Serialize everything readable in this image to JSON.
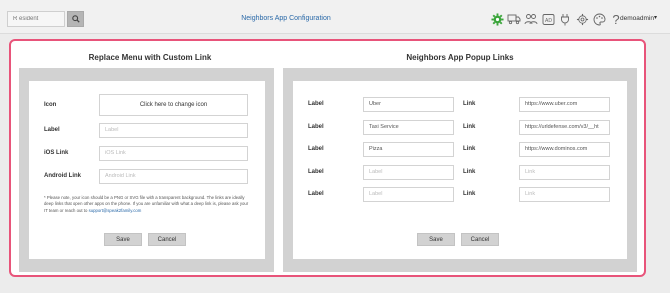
{
  "topbar": {
    "search_placeholder": "R esident",
    "title": "Neighbors App Configuration",
    "user": "demoadmin",
    "icons": [
      "settings-gear-icon",
      "truck-icon",
      "users-icon",
      "ad-icon",
      "plug-icon",
      "gear-icon",
      "palette-icon",
      "help-icon"
    ],
    "accent_color": "#3aa53a"
  },
  "left_panel": {
    "title": "Replace Menu with Custom Link",
    "icon_label": "Icon",
    "icon_button": "Click here to change icon",
    "label_label": "Label",
    "label_placeholder": "Label",
    "ios_label": "iOS Link",
    "ios_placeholder": "iOS Link",
    "android_label": "Android Link",
    "android_placeholder": "Android Link",
    "note_text": "* Please note, your icon should be a PNG or SVG file with a transparent background. The links are ideally deep links that open other apps on the phone. If you are unfamiliar with what a deep link is, please ask your IT team or reach out to",
    "note_link": "support@speak2family.com",
    "save": "Save",
    "cancel": "Cancel"
  },
  "right_panel": {
    "title": "Neighbors App Popup Links",
    "rows": [
      {
        "label_text": "Label",
        "label_value": "Uber",
        "link_text": "Link",
        "link_value": "https://www.uber.com"
      },
      {
        "label_text": "Label",
        "label_value": "Taxi Service",
        "link_text": "Link",
        "link_value": "https://urldefense.com/v3/__ht"
      },
      {
        "label_text": "Label",
        "label_value": "Pizza",
        "link_text": "Link",
        "link_value": "https://www.dominos.com"
      },
      {
        "label_text": "Label",
        "label_value": "Label",
        "link_text": "Link",
        "link_value": "Link"
      },
      {
        "label_text": "Label",
        "label_value": "Label",
        "link_text": "Link",
        "link_value": "Link"
      }
    ],
    "save": "Save",
    "cancel": "Cancel"
  },
  "colors": {
    "border_highlight": "#e8547a",
    "link": "#2a69a8"
  }
}
